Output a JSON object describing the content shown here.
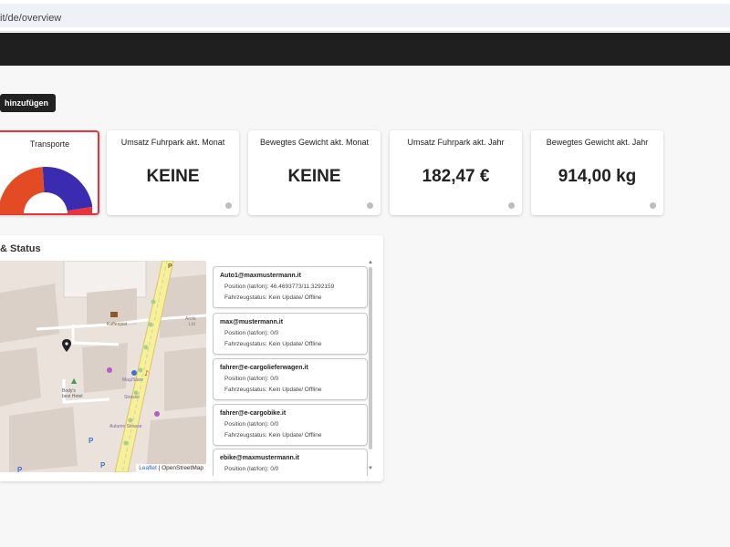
{
  "browser": {
    "url": "it/de/overview"
  },
  "toolbar": {
    "add_label": "hinzufügen"
  },
  "cards": [
    {
      "title": "Transporte",
      "value": ""
    },
    {
      "title": "Umsatz Fuhrpark akt. Monat",
      "value": "KEINE"
    },
    {
      "title": "Bewegtes Gewicht akt. Monat",
      "value": "KEINE"
    },
    {
      "title": "Umsatz Fuhrpark akt. Jahr",
      "value": "182,47 €"
    },
    {
      "title": "Bewegtes Gewicht akt. Jahr",
      "value": "914,00 kg"
    }
  ],
  "donut": {
    "segments": [
      {
        "label": "orange",
        "fraction": 0.48,
        "color": "#e34b24"
      },
      {
        "label": "blue",
        "fraction": 0.47,
        "color": "#3a2bb0"
      },
      {
        "label": "red",
        "fraction": 0.05,
        "color": "#e8333f"
      }
    ]
  },
  "status_panel": {
    "title": "& Status",
    "attribution_leaflet": "Leaflet",
    "attribution_sep": " | ",
    "attribution_osm": "OpenStreetMap",
    "map_labels": {
      "kaffeepiet": "Kaffeepiet",
      "arola": "Arola\nLtd",
      "bodys": "Body's\nbest Hotel",
      "megastore": "Mag/Stare\nStrasse",
      "autumn": "Autumn Strasse"
    }
  },
  "vehicles": [
    {
      "name": "Auto1@maxmustermann.it",
      "position": "Position (lat/lon): 46.4693773/11.3292159",
      "status": "Fahrzeugstatus: Kein Update/ Offline"
    },
    {
      "name": "max@mustermann.it",
      "position": "Position (lat/lon): 0/0",
      "status": "Fahrzeugstatus: Kein Update/ Offline"
    },
    {
      "name": "fahrer@e-cargolieferwagen.it",
      "position": "Position (lat/lon): 0/0",
      "status": "Fahrzeugstatus: Kein Update/ Offline"
    },
    {
      "name": "fahrer@e-cargobike.it",
      "position": "Position (lat/lon): 0/0",
      "status": "Fahrzeugstatus: Kein Update/ Offline"
    },
    {
      "name": "ebike@maxmustermann.it",
      "position": "Position (lat/lon): 0/0",
      "status": ""
    }
  ],
  "colors": {
    "accent": "#e8333f",
    "dark": "#1f1f1f"
  },
  "icons": {
    "map_pin": "map-pin-icon",
    "scroll_up": "chevron-up-icon",
    "scroll_down": "chevron-down-icon"
  }
}
